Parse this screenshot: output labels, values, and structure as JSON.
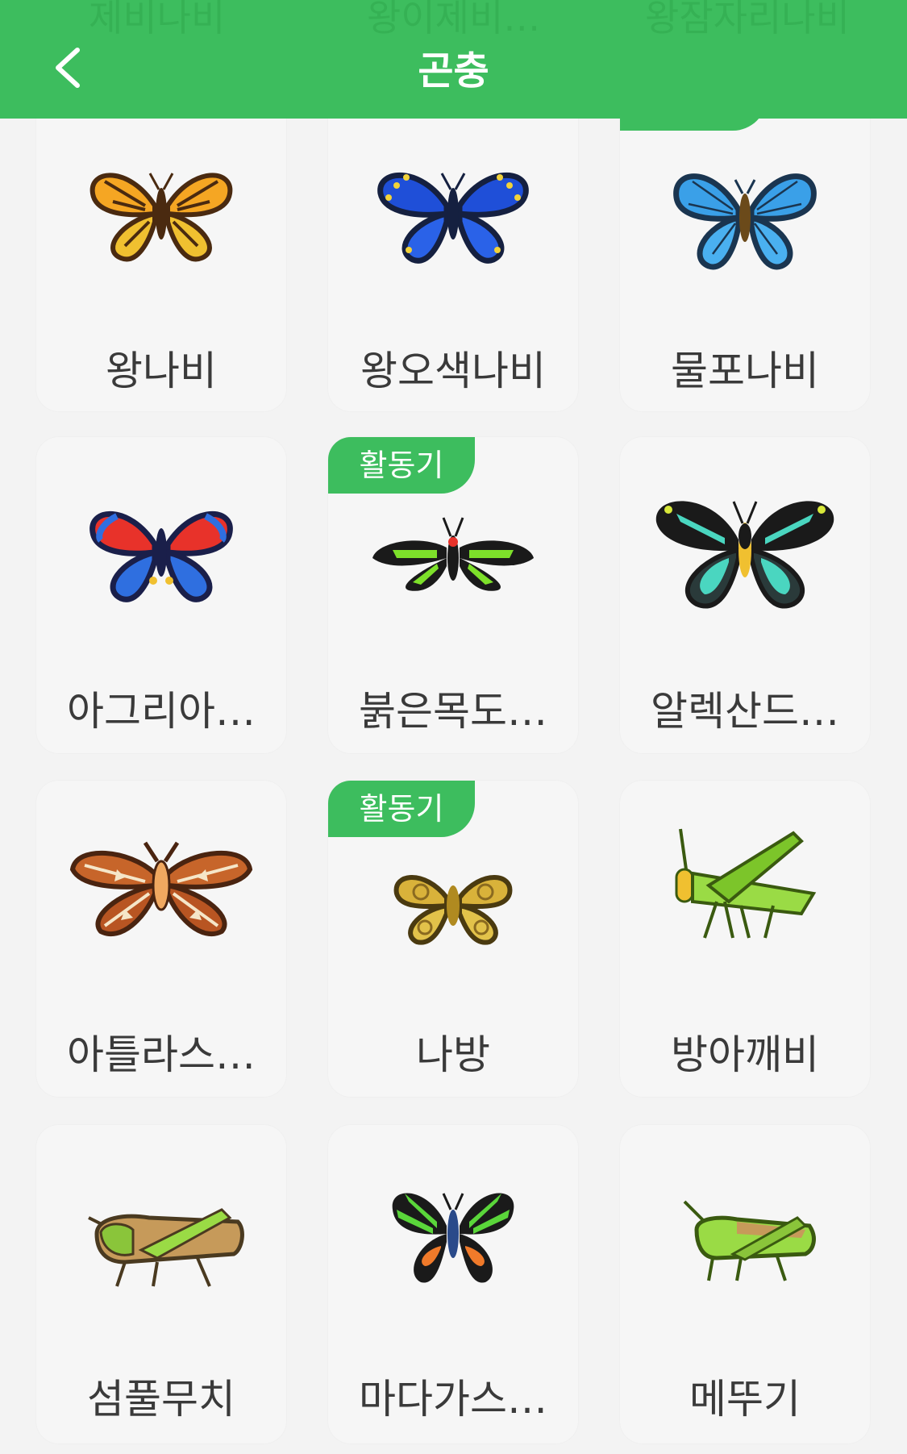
{
  "header": {
    "title": "곤충",
    "ghost_labels": [
      "제비나비",
      "왕이제비…",
      "왕잠자리나비"
    ]
  },
  "badge_label": "활동기",
  "colors": {
    "accent": "#3dbd5e",
    "background": "#f3f3f3",
    "card": "#f6f6f6",
    "text": "#3a3a3a"
  },
  "insects": [
    {
      "name": "왕나비",
      "icon": "monarch-butterfly-icon",
      "active": false
    },
    {
      "name": "왕오색나비",
      "icon": "emperor-butterfly-icon",
      "active": false
    },
    {
      "name": "물포나비",
      "icon": "blue-morpho-icon",
      "active": true
    },
    {
      "name": "아그리아…",
      "icon": "agrias-butterfly-icon",
      "active": false
    },
    {
      "name": "붉은목도…",
      "icon": "rajah-birdwing-icon",
      "active": true
    },
    {
      "name": "알렉산드…",
      "icon": "birdwing-butterfly-icon",
      "active": false
    },
    {
      "name": "아틀라스…",
      "icon": "atlas-moth-icon",
      "active": false
    },
    {
      "name": "나방",
      "icon": "moth-icon",
      "active": true
    },
    {
      "name": "방아깨비",
      "icon": "rice-grasshopper-icon",
      "active": false
    },
    {
      "name": "섬풀무치",
      "icon": "migratory-locust-icon",
      "active": false
    },
    {
      "name": "마다가스…",
      "icon": "madagascan-sunset-moth-icon",
      "active": false
    },
    {
      "name": "메뚜기",
      "icon": "grasshopper-icon",
      "active": false
    }
  ]
}
